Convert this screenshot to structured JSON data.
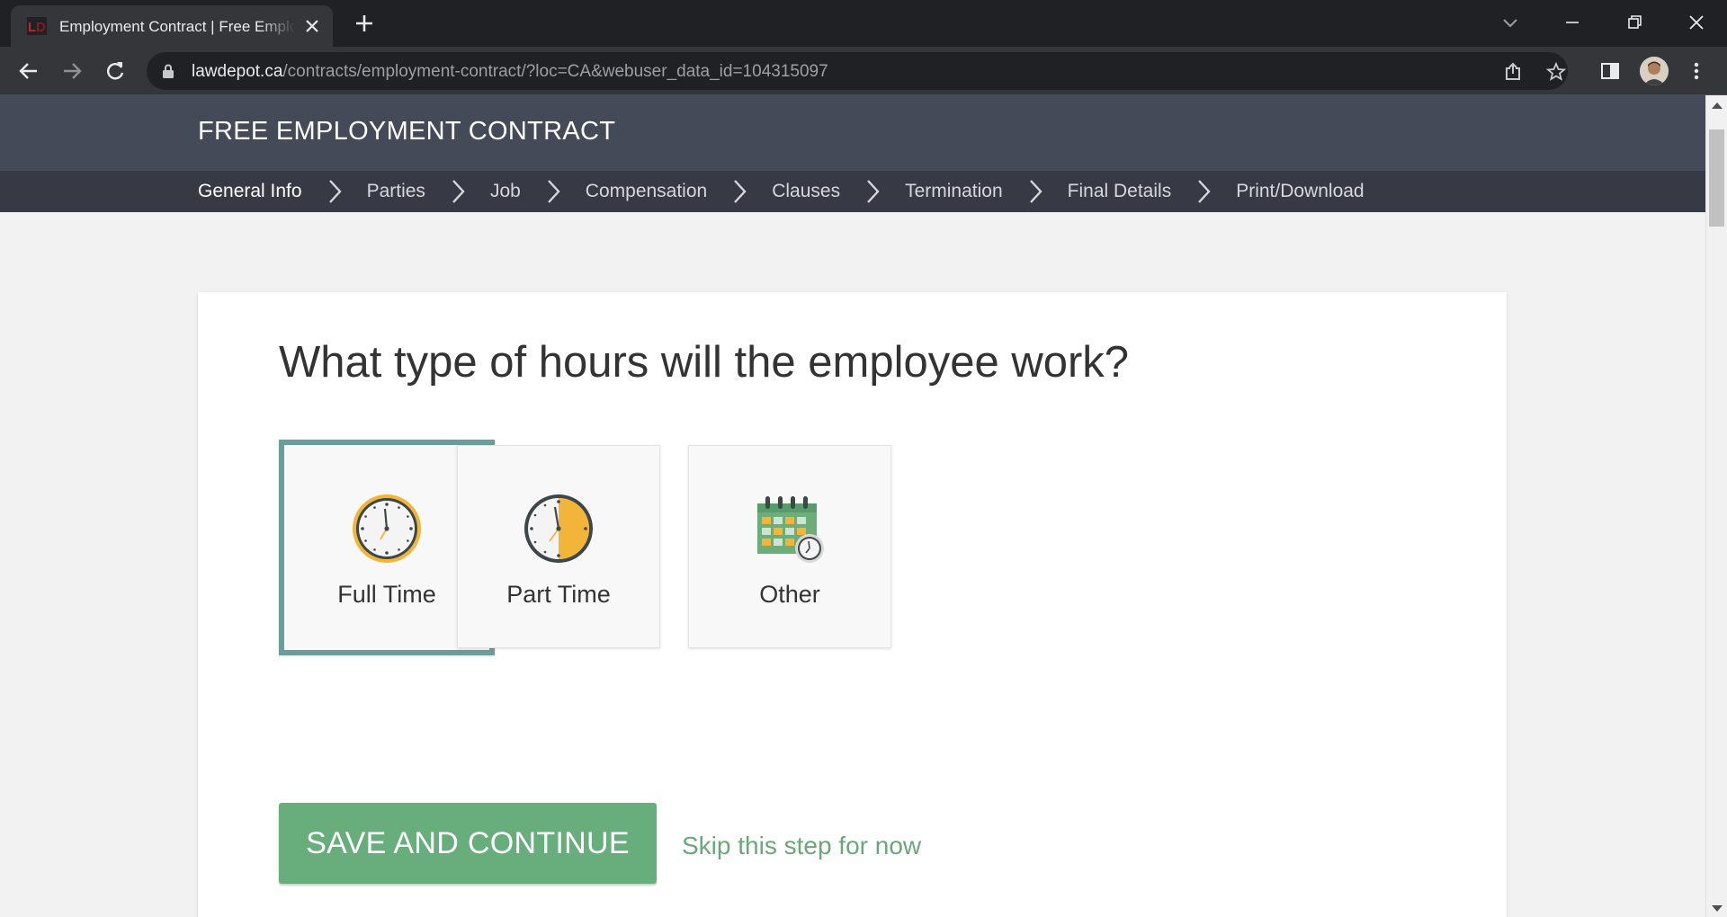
{
  "browser": {
    "tab_title": "Employment Contract | Free Employment Contract",
    "url_host": "lawdepot.ca",
    "url_path": "/contracts/employment-contract/?loc=CA&webuser_data_id=104315097"
  },
  "header": {
    "title": "FREE EMPLOYMENT CONTRACT"
  },
  "steps": [
    {
      "label": "General Info",
      "active": true
    },
    {
      "label": "Parties"
    },
    {
      "label": "Job"
    },
    {
      "label": "Compensation"
    },
    {
      "label": "Clauses"
    },
    {
      "label": "Termination"
    },
    {
      "label": "Final Details"
    },
    {
      "label": "Print/Download"
    }
  ],
  "question": "What type of hours will the employee work?",
  "options": [
    {
      "label": "Full Time",
      "icon": "full-clock-icon",
      "selected": true
    },
    {
      "label": "Part Time",
      "icon": "half-clock-icon",
      "selected": false
    },
    {
      "label": "Other",
      "icon": "calendar-clock-icon",
      "selected": false
    }
  ],
  "actions": {
    "save_label": "SAVE AND CONTINUE",
    "skip_label": "Skip this step for now"
  },
  "colors": {
    "header_bg": "#454a58",
    "stepnav_bg": "#373a44",
    "selected_border": "#6a9e9a",
    "save_button": "#67ae7c",
    "skip_link": "#6aa87b"
  }
}
